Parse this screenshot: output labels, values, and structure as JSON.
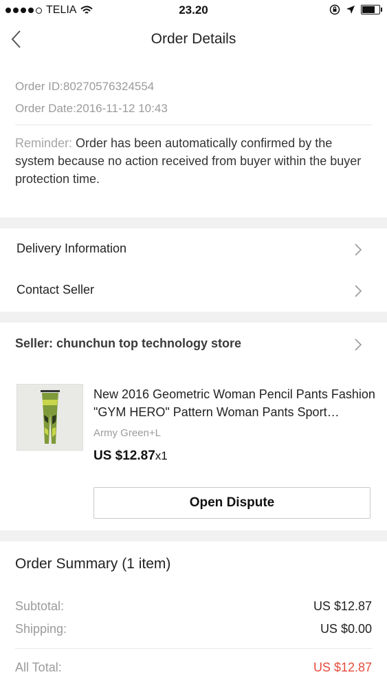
{
  "status_bar": {
    "carrier": "TELIA",
    "time": "23.20",
    "battery_level": 0.7
  },
  "nav": {
    "title": "Order Details",
    "back_icon": "chevron-left-icon"
  },
  "order": {
    "id_text": "Order ID:80270576324554",
    "date_text": "Order Date:2016-11-12 10:43",
    "reminder_label": "Reminder:",
    "reminder_text": " Order has been automatically confirmed by the system because no action received from buyer within the buyer protection time."
  },
  "links": {
    "delivery_info": "Delivery Information",
    "contact_seller": "Contact Seller"
  },
  "seller": {
    "label": "Seller: chunchun top technology store"
  },
  "product": {
    "title": "New 2016 Geometric Woman Pencil Pants Fashion \"GYM HERO\" Pattern Woman Pants Sport Leggings",
    "variant": "Army Green+L",
    "price": "US $12.87",
    "quantity": "x1"
  },
  "actions": {
    "open_dispute": "Open Dispute"
  },
  "summary": {
    "title": "Order Summary (1 item)",
    "subtotal_label": "Subtotal:",
    "subtotal_value": "US $12.87",
    "shipping_label": "Shipping:",
    "shipping_value": "US $0.00",
    "total_label": "All Total:",
    "total_value": "US $12.87"
  },
  "colors": {
    "accent_price": "#e54b3c",
    "section_gap": "#f1f1f1"
  }
}
